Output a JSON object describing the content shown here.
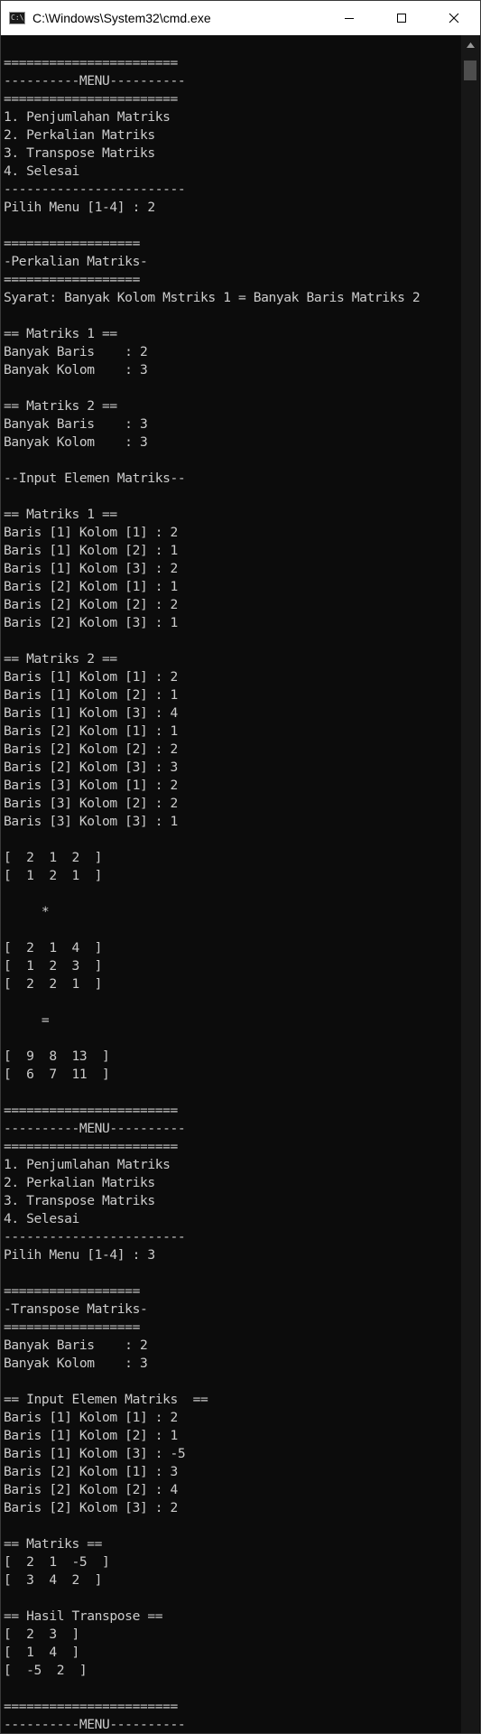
{
  "window": {
    "title": "C:\\Windows\\System32\\cmd.exe",
    "icon_text": "C:\\_",
    "controls": [
      "minimize-icon",
      "maximize-icon",
      "close-icon"
    ]
  },
  "console": {
    "lines": [
      "=======================",
      "----------MENU----------",
      "=======================",
      "1. Penjumlahan Matriks",
      "2. Perkalian Matriks",
      "3. Transpose Matriks",
      "4. Selesai",
      "------------------------",
      "Pilih Menu [1-4] : 2",
      "",
      "==================",
      "-Perkalian Matriks-",
      "==================",
      "Syarat: Banyak Kolom Mstriks 1 = Banyak Baris Matriks 2",
      "",
      "== Matriks 1 ==",
      "Banyak Baris    : 2",
      "Banyak Kolom    : 3",
      "",
      "== Matriks 2 ==",
      "Banyak Baris    : 3",
      "Banyak Kolom    : 3",
      "",
      "--Input Elemen Matriks--",
      "",
      "== Matriks 1 ==",
      "Baris [1] Kolom [1] : 2",
      "Baris [1] Kolom [2] : 1",
      "Baris [1] Kolom [3] : 2",
      "Baris [2] Kolom [1] : 1",
      "Baris [2] Kolom [2] : 2",
      "Baris [2] Kolom [3] : 1",
      "",
      "== Matriks 2 ==",
      "Baris [1] Kolom [1] : 2",
      "Baris [1] Kolom [2] : 1",
      "Baris [1] Kolom [3] : 4",
      "Baris [2] Kolom [1] : 1",
      "Baris [2] Kolom [2] : 2",
      "Baris [2] Kolom [3] : 3",
      "Baris [3] Kolom [1] : 2",
      "Baris [3] Kolom [2] : 2",
      "Baris [3] Kolom [3] : 1",
      "",
      "[  2  1  2  ]",
      "[  1  2  1  ]",
      "",
      "     *",
      "",
      "[  2  1  4  ]",
      "[  1  2  3  ]",
      "[  2  2  1  ]",
      "",
      "     =",
      "",
      "[  9  8  13  ]",
      "[  6  7  11  ]",
      "",
      "=======================",
      "----------MENU----------",
      "=======================",
      "1. Penjumlahan Matriks",
      "2. Perkalian Matriks",
      "3. Transpose Matriks",
      "4. Selesai",
      "------------------------",
      "Pilih Menu [1-4] : 3",
      "",
      "==================",
      "-Transpose Matriks-",
      "==================",
      "Banyak Baris    : 2",
      "Banyak Kolom    : 3",
      "",
      "== Input Elemen Matriks  ==",
      "Baris [1] Kolom [1] : 2",
      "Baris [1] Kolom [2] : 1",
      "Baris [1] Kolom [3] : -5",
      "Baris [2] Kolom [1] : 3",
      "Baris [2] Kolom [2] : 4",
      "Baris [2] Kolom [3] : 2",
      "",
      "== Matriks ==",
      "[  2  1  -5  ]",
      "[  3  4  2  ]",
      "",
      "== Hasil Transpose ==",
      "[  2  3  ]",
      "[  1  4  ]",
      "[  -5  2  ]",
      "",
      "=======================",
      "----------MENU----------"
    ]
  },
  "colors": {
    "background": "#0c0c0c",
    "text": "#cccccc",
    "titlebar": "#ffffff"
  }
}
